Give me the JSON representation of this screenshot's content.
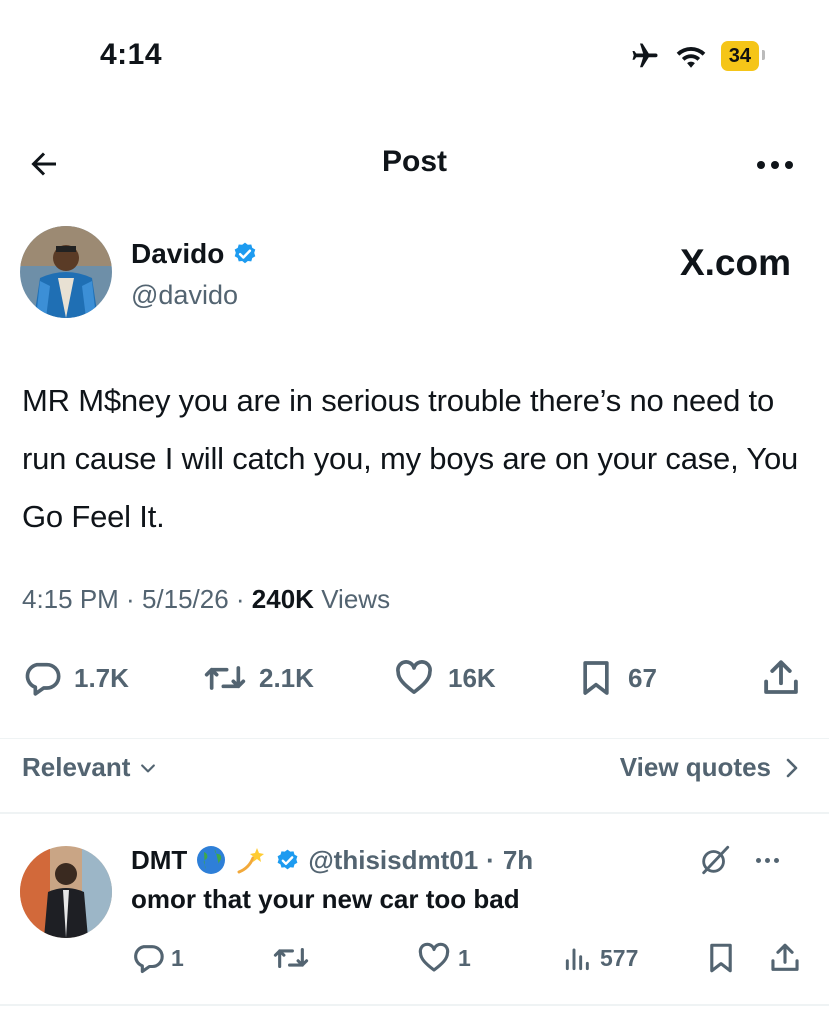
{
  "status_bar": {
    "time": "4:14",
    "battery": "34",
    "icons": [
      "airplane-icon",
      "wifi-icon",
      "battery-icon"
    ]
  },
  "nav": {
    "title": "Post",
    "icons": [
      "back-arrow-icon",
      "more-icon"
    ]
  },
  "author": {
    "name": "Davido",
    "handle": "@davido",
    "verified": true
  },
  "watermark": "X.com",
  "tweet": {
    "text": "MR M$ney you are in serious trouble there’s no need to run cause I will catch you, my boys are on your case, You Go Feel It.",
    "time": "4:15 PM",
    "date": "5/15/26",
    "views": "240K",
    "views_label": "Views"
  },
  "actions": {
    "replies": "1.7K",
    "reposts": "2.1K",
    "likes": "16K",
    "bookmarks": "67"
  },
  "sort": {
    "label": "Relevant",
    "view_quotes": "View quotes"
  },
  "reply": {
    "name": "DMT",
    "emojis": [
      "globe-icon",
      "dizzy-icon"
    ],
    "handle": "@thisisdmt01",
    "time": "7h",
    "text": "omor that your new car too bad",
    "replies": "1",
    "likes": "1",
    "views": "577"
  },
  "colors": {
    "verified": "#1d9bf0",
    "text": "#0f1419",
    "secondary": "#536471",
    "battery": "#f5c518"
  }
}
